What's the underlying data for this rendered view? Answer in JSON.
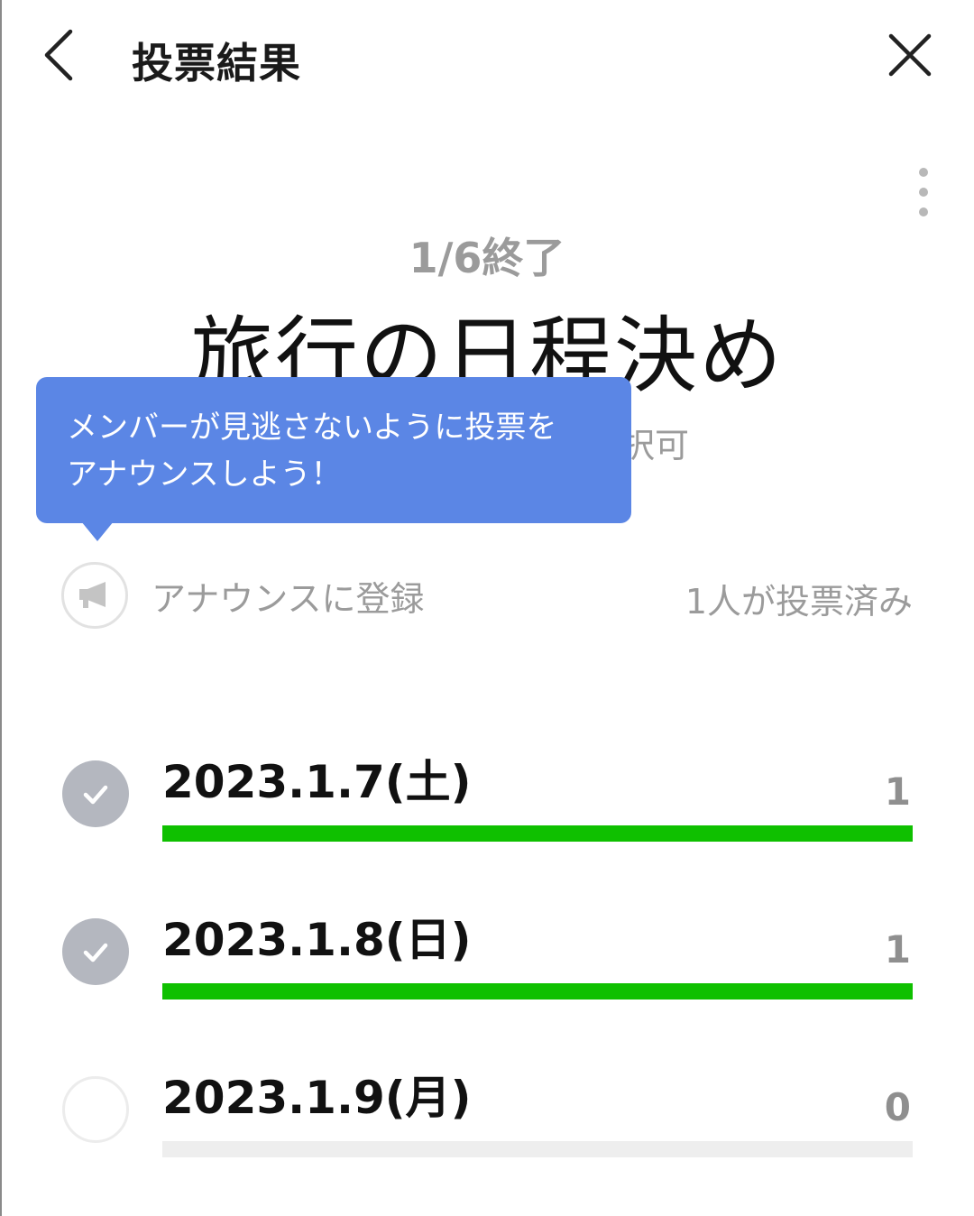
{
  "header": {
    "title": "投票結果",
    "back_icon": "chevron-left-icon",
    "close_icon": "close-icon",
    "more_icon": "more-vertical-icon"
  },
  "poll": {
    "deadline": "1/6終了",
    "title": "旅行の日程決め",
    "select_mode_visible": "選択可"
  },
  "tooltip": {
    "line1": "メンバーが見逃さないように投票を",
    "line2": "アナウンスしよう！",
    "color": "#5b86e5"
  },
  "announce": {
    "label": "アナウンスに登録",
    "icon": "megaphone-icon"
  },
  "voted_summary": "1人が投票済み",
  "options": [
    {
      "label": "2023.1.7(土)",
      "count": "1",
      "checked": true,
      "fill": 1.0
    },
    {
      "label": "2023.1.8(日)",
      "count": "1",
      "checked": true,
      "fill": 1.0
    },
    {
      "label": "2023.1.9(月)",
      "count": "0",
      "checked": false,
      "fill": 0.0
    }
  ],
  "colors": {
    "bar_fill": "#0fc000",
    "bar_track": "#eeeeee",
    "check_bg": "#b4b7bf"
  }
}
